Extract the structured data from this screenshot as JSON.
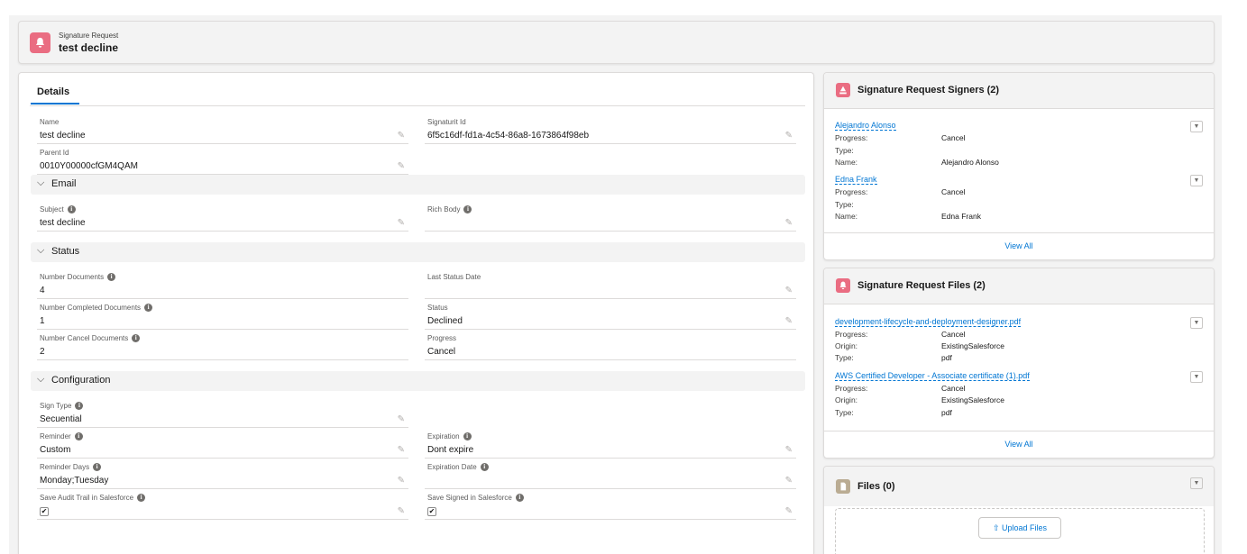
{
  "header": {
    "object_label": "Signature Request",
    "record_title": "test decline"
  },
  "tabs": {
    "details": "Details"
  },
  "fields": {
    "name": {
      "label": "Name",
      "value": "test decline"
    },
    "signaturit_id": {
      "label": "Signaturit Id",
      "value": "6f5c16df-fd1a-4c54-86a8-1673864f98eb"
    },
    "parent_id": {
      "label": "Parent Id",
      "value": "0010Y00000cfGM4QAM"
    }
  },
  "sections": {
    "email": "Email",
    "status": "Status",
    "configuration": "Configuration"
  },
  "email": {
    "subject": {
      "label": "Subject",
      "value": "test decline"
    },
    "rich_body": {
      "label": "Rich Body",
      "value": ""
    }
  },
  "status": {
    "number_documents": {
      "label": "Number Documents",
      "value": "4"
    },
    "last_status_date": {
      "label": "Last Status Date",
      "value": ""
    },
    "number_completed": {
      "label": "Number Completed Documents",
      "value": "1"
    },
    "status": {
      "label": "Status",
      "value": "Declined"
    },
    "number_cancel": {
      "label": "Number Cancel Documents",
      "value": "2"
    },
    "progress": {
      "label": "Progress",
      "value": "Cancel"
    }
  },
  "configuration": {
    "sign_type": {
      "label": "Sign Type",
      "value": "Secuential"
    },
    "reminder": {
      "label": "Reminder",
      "value": "Custom"
    },
    "expiration": {
      "label": "Expiration",
      "value": "Dont expire"
    },
    "reminder_days": {
      "label": "Reminder Days",
      "value": "Monday;Tuesday"
    },
    "expiration_date": {
      "label": "Expiration Date",
      "value": ""
    },
    "save_audit_trail": {
      "label": "Save Audit Trail in Salesforce",
      "checked": true
    },
    "save_signed": {
      "label": "Save Signed in Salesforce",
      "checked": true
    }
  },
  "signers": {
    "title": "Signature Request Signers (2)",
    "labels": {
      "progress": "Progress:",
      "type": "Type:",
      "name": "Name:"
    },
    "items": [
      {
        "name_link": "Alejandro Alonso",
        "progress": "Cancel",
        "type": "",
        "name": "Alejandro Alonso"
      },
      {
        "name_link": "Edna Frank",
        "progress": "Cancel",
        "type": "",
        "name": "Edna Frank"
      }
    ],
    "view_all": "View All"
  },
  "files_rel": {
    "title": "Signature Request Files (2)",
    "labels": {
      "progress": "Progress:",
      "origin": "Origin:",
      "type": "Type:"
    },
    "items": [
      {
        "file_link": "development-lifecycle-and-deployment-designer.pdf",
        "progress": "Cancel",
        "origin": "ExistingSalesforce",
        "type": "pdf"
      },
      {
        "file_link": "AWS Certified Developer - Associate certificate (1).pdf",
        "progress": "Cancel",
        "origin": "ExistingSalesforce",
        "type": "pdf"
      }
    ],
    "view_all": "View All"
  },
  "files": {
    "title": "Files (0)",
    "upload_label": "Upload Files"
  },
  "colors": {
    "accent": "#0176d3",
    "signature_icon": "#ea6d82",
    "files_icon": "#baac93"
  }
}
